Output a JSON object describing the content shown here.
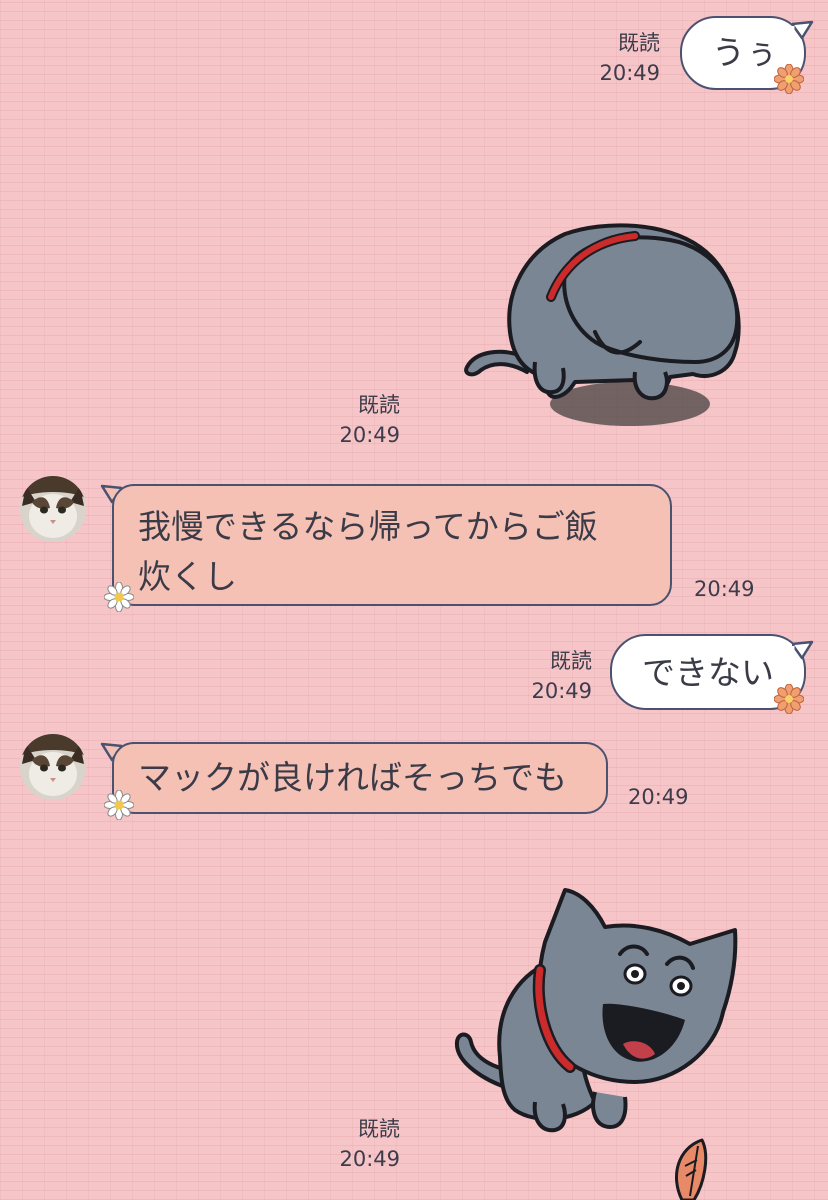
{
  "messages": [
    {
      "id": "m1",
      "direction": "outgoing",
      "type": "text",
      "text": "うぅ",
      "read": "既読",
      "time": "20:49"
    },
    {
      "id": "m2",
      "direction": "outgoing",
      "type": "sticker",
      "sticker": "sad-gray-cat-sticker",
      "read": "既読",
      "time": "20:49"
    },
    {
      "id": "m3",
      "direction": "incoming",
      "type": "text",
      "lines": [
        "我慢できるなら帰ってからご飯",
        "炊くし"
      ],
      "time": "20:49"
    },
    {
      "id": "m4",
      "direction": "outgoing",
      "type": "text",
      "text": "できない",
      "read": "既読",
      "time": "20:49"
    },
    {
      "id": "m5",
      "direction": "incoming",
      "type": "text",
      "text": "マックが良ければそっちでも",
      "time": "20:49"
    },
    {
      "id": "m6",
      "direction": "outgoing",
      "type": "sticker",
      "sticker": "grinning-gray-cat-sticker",
      "read": "既読",
      "time": "20:49"
    }
  ],
  "contact": {
    "avatar": "cat-photo-avatar"
  },
  "colors": {
    "background": "#f6c5c8",
    "incoming_bubble": "#f5c1b5",
    "outgoing_bubble": "#ffffff",
    "bubble_border": "#4a5270",
    "cat_body": "#7b8694",
    "cat_collar": "#cc2b2b"
  }
}
